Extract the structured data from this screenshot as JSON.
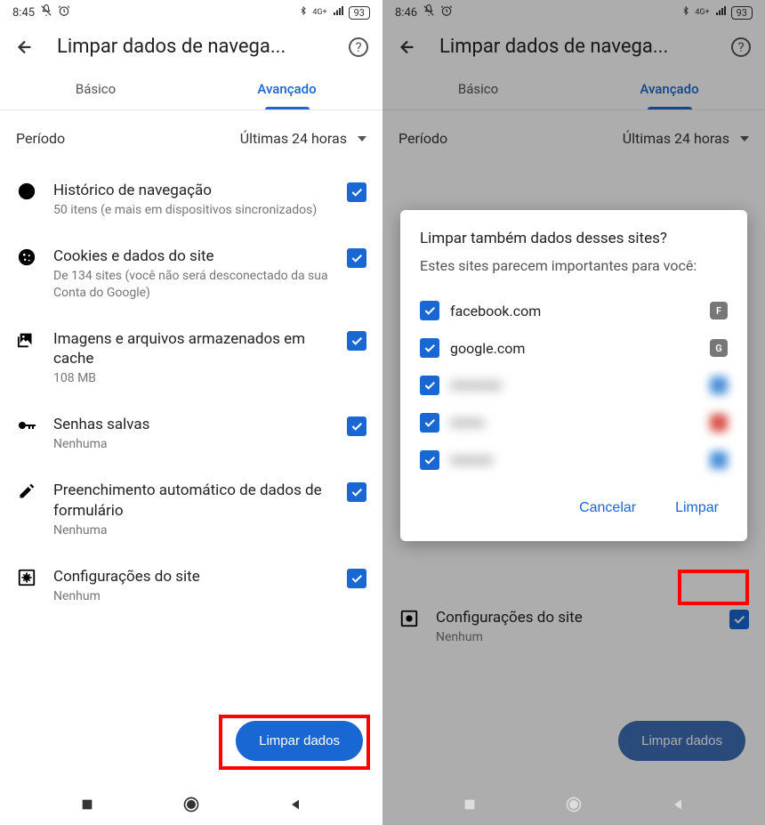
{
  "left": {
    "status": {
      "time": "8:45",
      "battery": "93"
    },
    "header": {
      "title": "Limpar dados de navega..."
    },
    "tabs": {
      "basic": "Básico",
      "advanced": "Avançado"
    },
    "period": {
      "label": "Período",
      "value": "Últimas 24 horas"
    },
    "items": [
      {
        "icon": "history",
        "title": "Histórico de navegação",
        "sub": "50 itens (e mais em dispositivos sincronizados)"
      },
      {
        "icon": "cookie",
        "title": "Cookies e dados do site",
        "sub": "De 134 sites (você não será desconectado da sua Conta do Google)"
      },
      {
        "icon": "image",
        "title": "Imagens e arquivos armazenados em cache",
        "sub": "108 MB"
      },
      {
        "icon": "key",
        "title": "Senhas salvas",
        "sub": "Nenhuma"
      },
      {
        "icon": "edit",
        "title": "Preenchimento automático de dados de formulário",
        "sub": "Nenhuma"
      },
      {
        "icon": "settings-box",
        "title": "Configurações do site",
        "sub": "Nenhum"
      }
    ],
    "clear_button": "Limpar dados"
  },
  "right": {
    "status": {
      "time": "8:46",
      "battery": "93"
    },
    "header": {
      "title": "Limpar dados de navega..."
    },
    "tabs": {
      "basic": "Básico",
      "advanced": "Avançado"
    },
    "period": {
      "label": "Período",
      "value": "Últimas 24 horas"
    },
    "site_settings": {
      "title": "Configurações do site",
      "sub": "Nenhum"
    },
    "clear_button": "Limpar dados",
    "dialog": {
      "title": "Limpar também dados desses sites?",
      "sub": "Estes sites parecem importantes para você:",
      "sites": [
        {
          "name": "facebook.com",
          "favicon": "F",
          "blurred": false
        },
        {
          "name": "google.com",
          "favicon": "G",
          "blurred": false
        },
        {
          "name": "■■■■■■",
          "favicon": "",
          "blurred": true
        },
        {
          "name": "■■■■",
          "favicon": "",
          "blurred": true
        },
        {
          "name": "■■■■■",
          "favicon": "",
          "blurred": true
        }
      ],
      "cancel": "Cancelar",
      "confirm": "Limpar"
    }
  }
}
